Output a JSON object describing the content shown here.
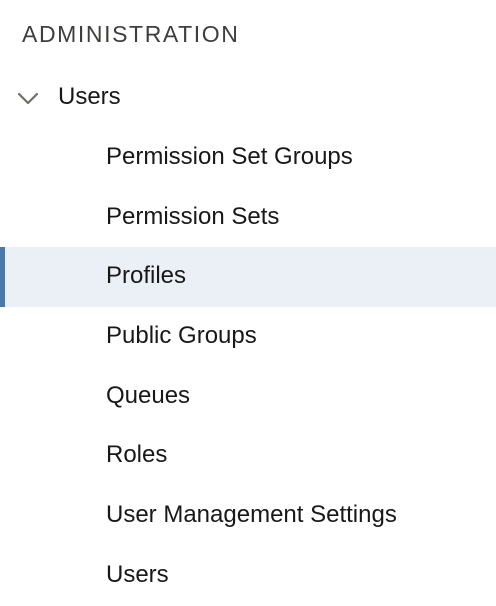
{
  "section": {
    "title": "ADMINISTRATION"
  },
  "group": {
    "label": "Users",
    "expanded": true,
    "icon": "chevron-down-icon"
  },
  "items": [
    {
      "label": "Permission Set Groups",
      "selected": false
    },
    {
      "label": "Permission Sets",
      "selected": false
    },
    {
      "label": "Profiles",
      "selected": true
    },
    {
      "label": "Public Groups",
      "selected": false
    },
    {
      "label": "Queues",
      "selected": false
    },
    {
      "label": "Roles",
      "selected": false
    },
    {
      "label": "User Management Settings",
      "selected": false
    },
    {
      "label": "Users",
      "selected": false
    }
  ],
  "colors": {
    "selected_background": "#eaf0f6",
    "selected_indicator": "#4a7aa7"
  }
}
